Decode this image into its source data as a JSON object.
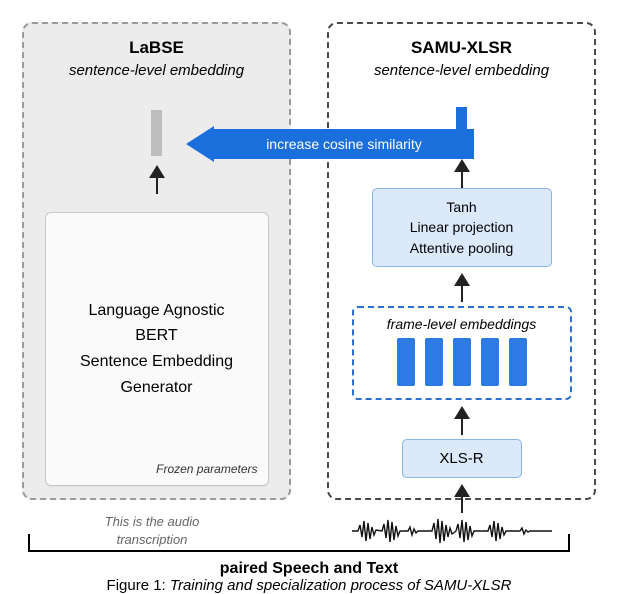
{
  "left": {
    "title": "LaBSE",
    "subtitle": "sentence-level embedding",
    "box_line1": "Language Agnostic",
    "box_line2": "BERT",
    "box_line3": "Sentence Embedding",
    "box_line4": "Generator",
    "frozen": "Frozen parameters",
    "input_line1": "This is the audio",
    "input_line2": "transcription"
  },
  "right": {
    "title": "SAMU-XLSR",
    "subtitle": "sentence-level embedding",
    "tanh_line1": "Tanh",
    "tanh_line2": "Linear projection",
    "tanh_line3": "Attentive pooling",
    "frame_label": "frame-level embeddings",
    "xlsr": "XLS-R"
  },
  "cosine": "increase cosine similarity",
  "paired": "paired Speech and Text",
  "caption_prefix": "Figure 1: ",
  "caption_text": "Training and specialization process of SAMU-XLSR"
}
